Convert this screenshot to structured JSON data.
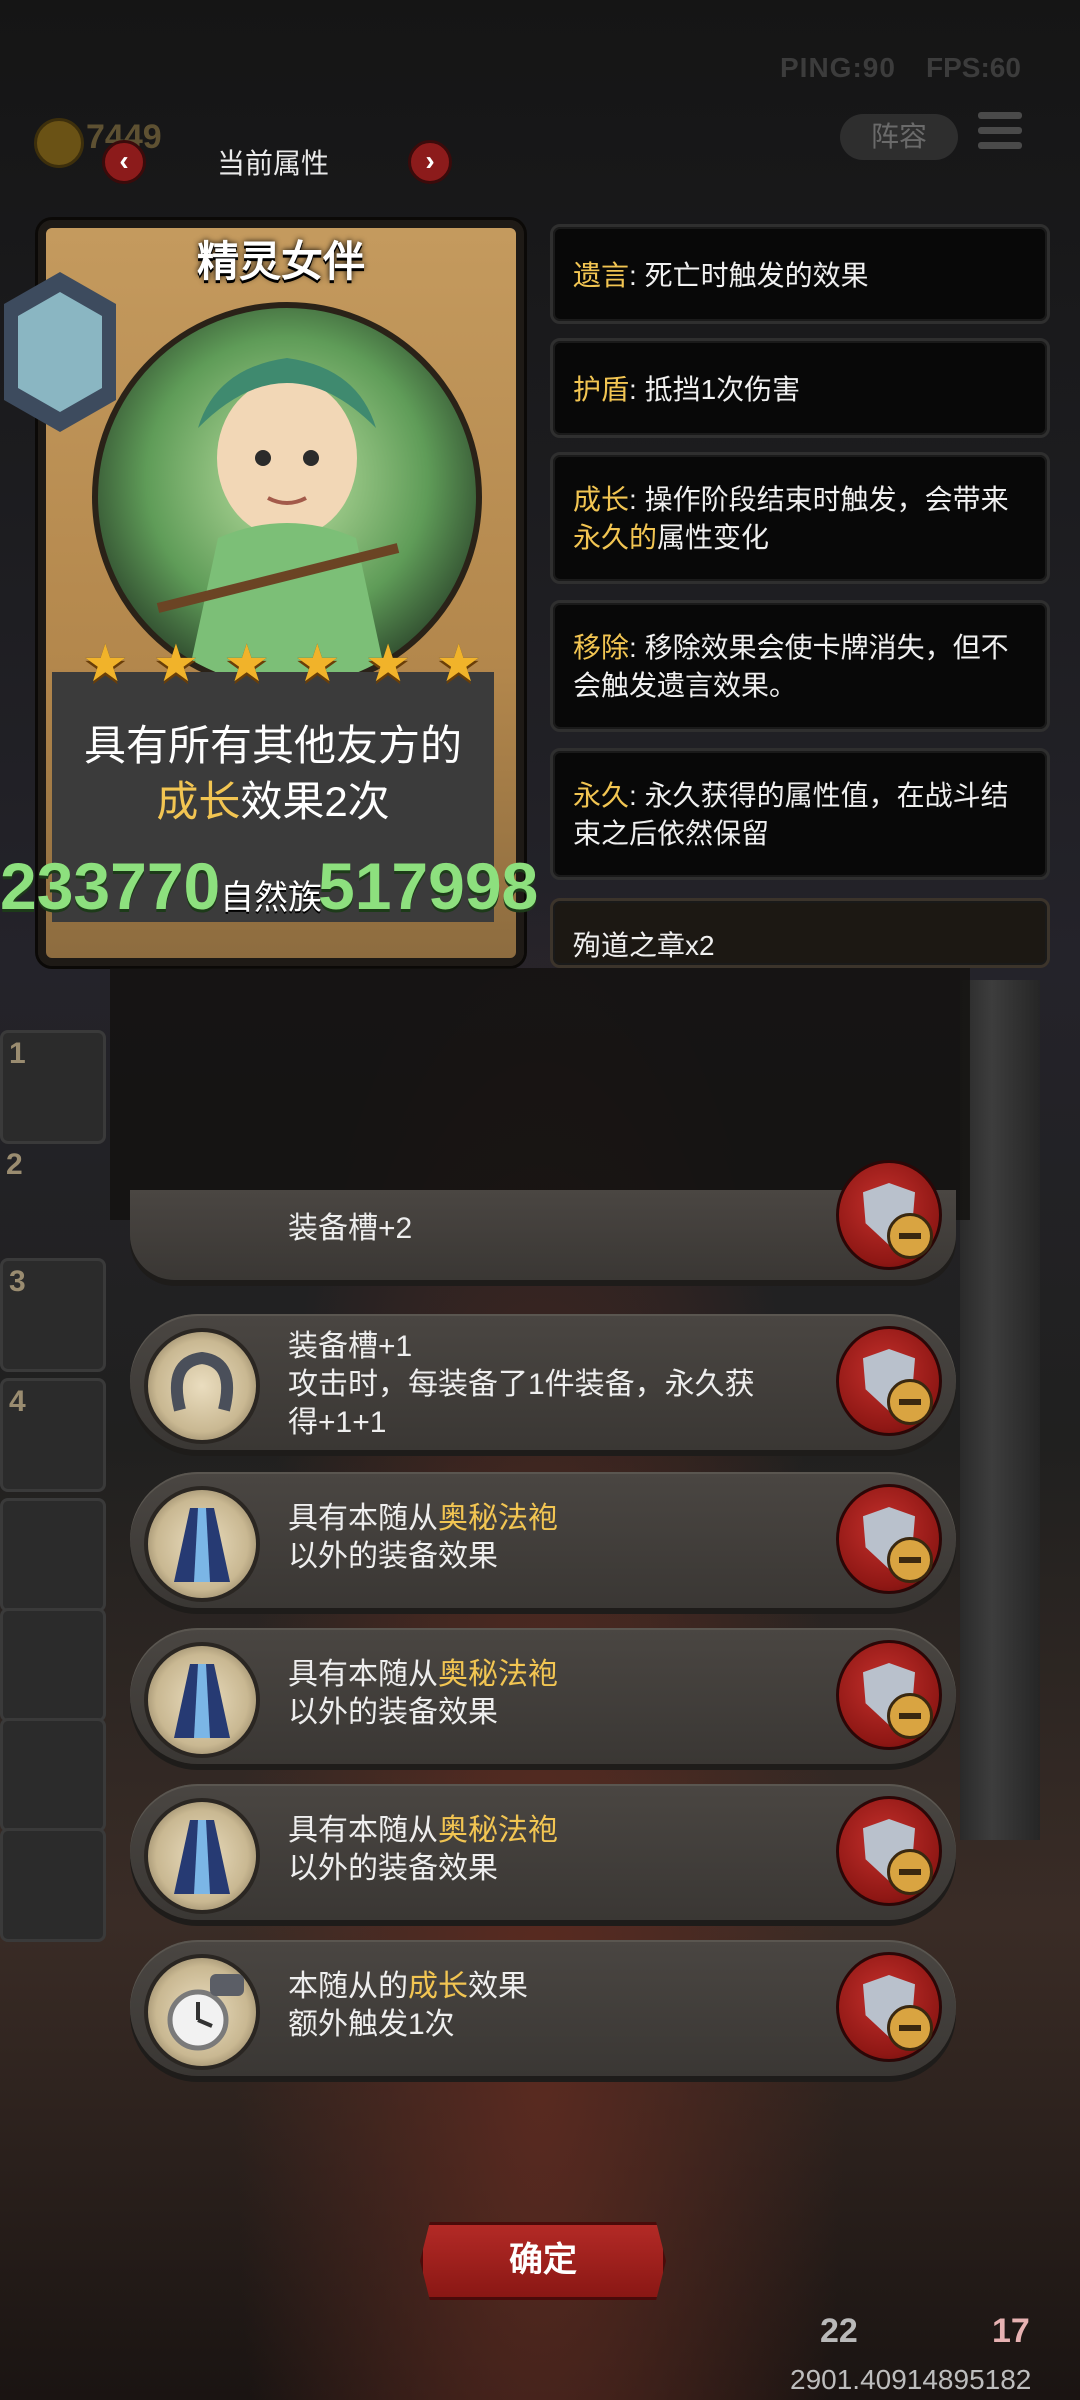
{
  "hud": {
    "ping": "PING:90",
    "fps": "FPS:60",
    "gold": "7449",
    "lineup_label": "阵容"
  },
  "header": {
    "prev_symbol": "‹",
    "next_symbol": "›",
    "title": "当前属性"
  },
  "card": {
    "name": "精灵女伴",
    "stars": 6,
    "description_line1": "具有所有其他友方的",
    "description_line2_keyword": "成长",
    "description_line2_rest": "效果2次"
  },
  "stats": {
    "value_left": "233770",
    "label": "自然族",
    "value_right": "517998"
  },
  "keywords": [
    {
      "term": "遗言",
      "text": ": 死亡时触发的效果"
    },
    {
      "term": "护盾",
      "text": ": 抵挡1次伤害"
    },
    {
      "term": "成长",
      "text_a": ": 操作阶段结束时触发，会带来",
      "highlight": "永久的",
      "text_b": "属性变化"
    },
    {
      "term": "移除",
      "text": ": 移除效果会使卡牌消失，但不会触发遗言效果。"
    },
    {
      "term": "永久",
      "text": ": 永久获得的属性值，在战斗结束之后依然保留"
    }
  ],
  "extra_item": "殉道之章x2",
  "slots": [
    "1",
    "2",
    "3",
    "4"
  ],
  "equipment": [
    {
      "line1": "装备槽+2",
      "line2": "",
      "line3": ""
    },
    {
      "line1": "装备槽+1",
      "line2": "攻击时，每装备了1件装备，永久获",
      "line3": "得+1+1"
    },
    {
      "pre": "具有本随从",
      "keyword": "奥秘法袍",
      "line2": "以外的装备效果"
    },
    {
      "pre": "具有本随从",
      "keyword": "奥秘法袍",
      "line2": "以外的装备效果"
    },
    {
      "pre": "具有本随从",
      "keyword": "奥秘法袍",
      "line2": "以外的装备效果"
    },
    {
      "pre": "本随从的",
      "keyword": "成长",
      "post": "效果",
      "line2": "额外触发1次"
    }
  ],
  "confirm_label": "确定",
  "bottom": {
    "stat_a": "22",
    "stat_b": "17",
    "coords": "2901.40914895182"
  },
  "colors": {
    "accent_gold": "#f2c552",
    "stat_green": "#8de07e",
    "button_red": "#b32a26"
  }
}
